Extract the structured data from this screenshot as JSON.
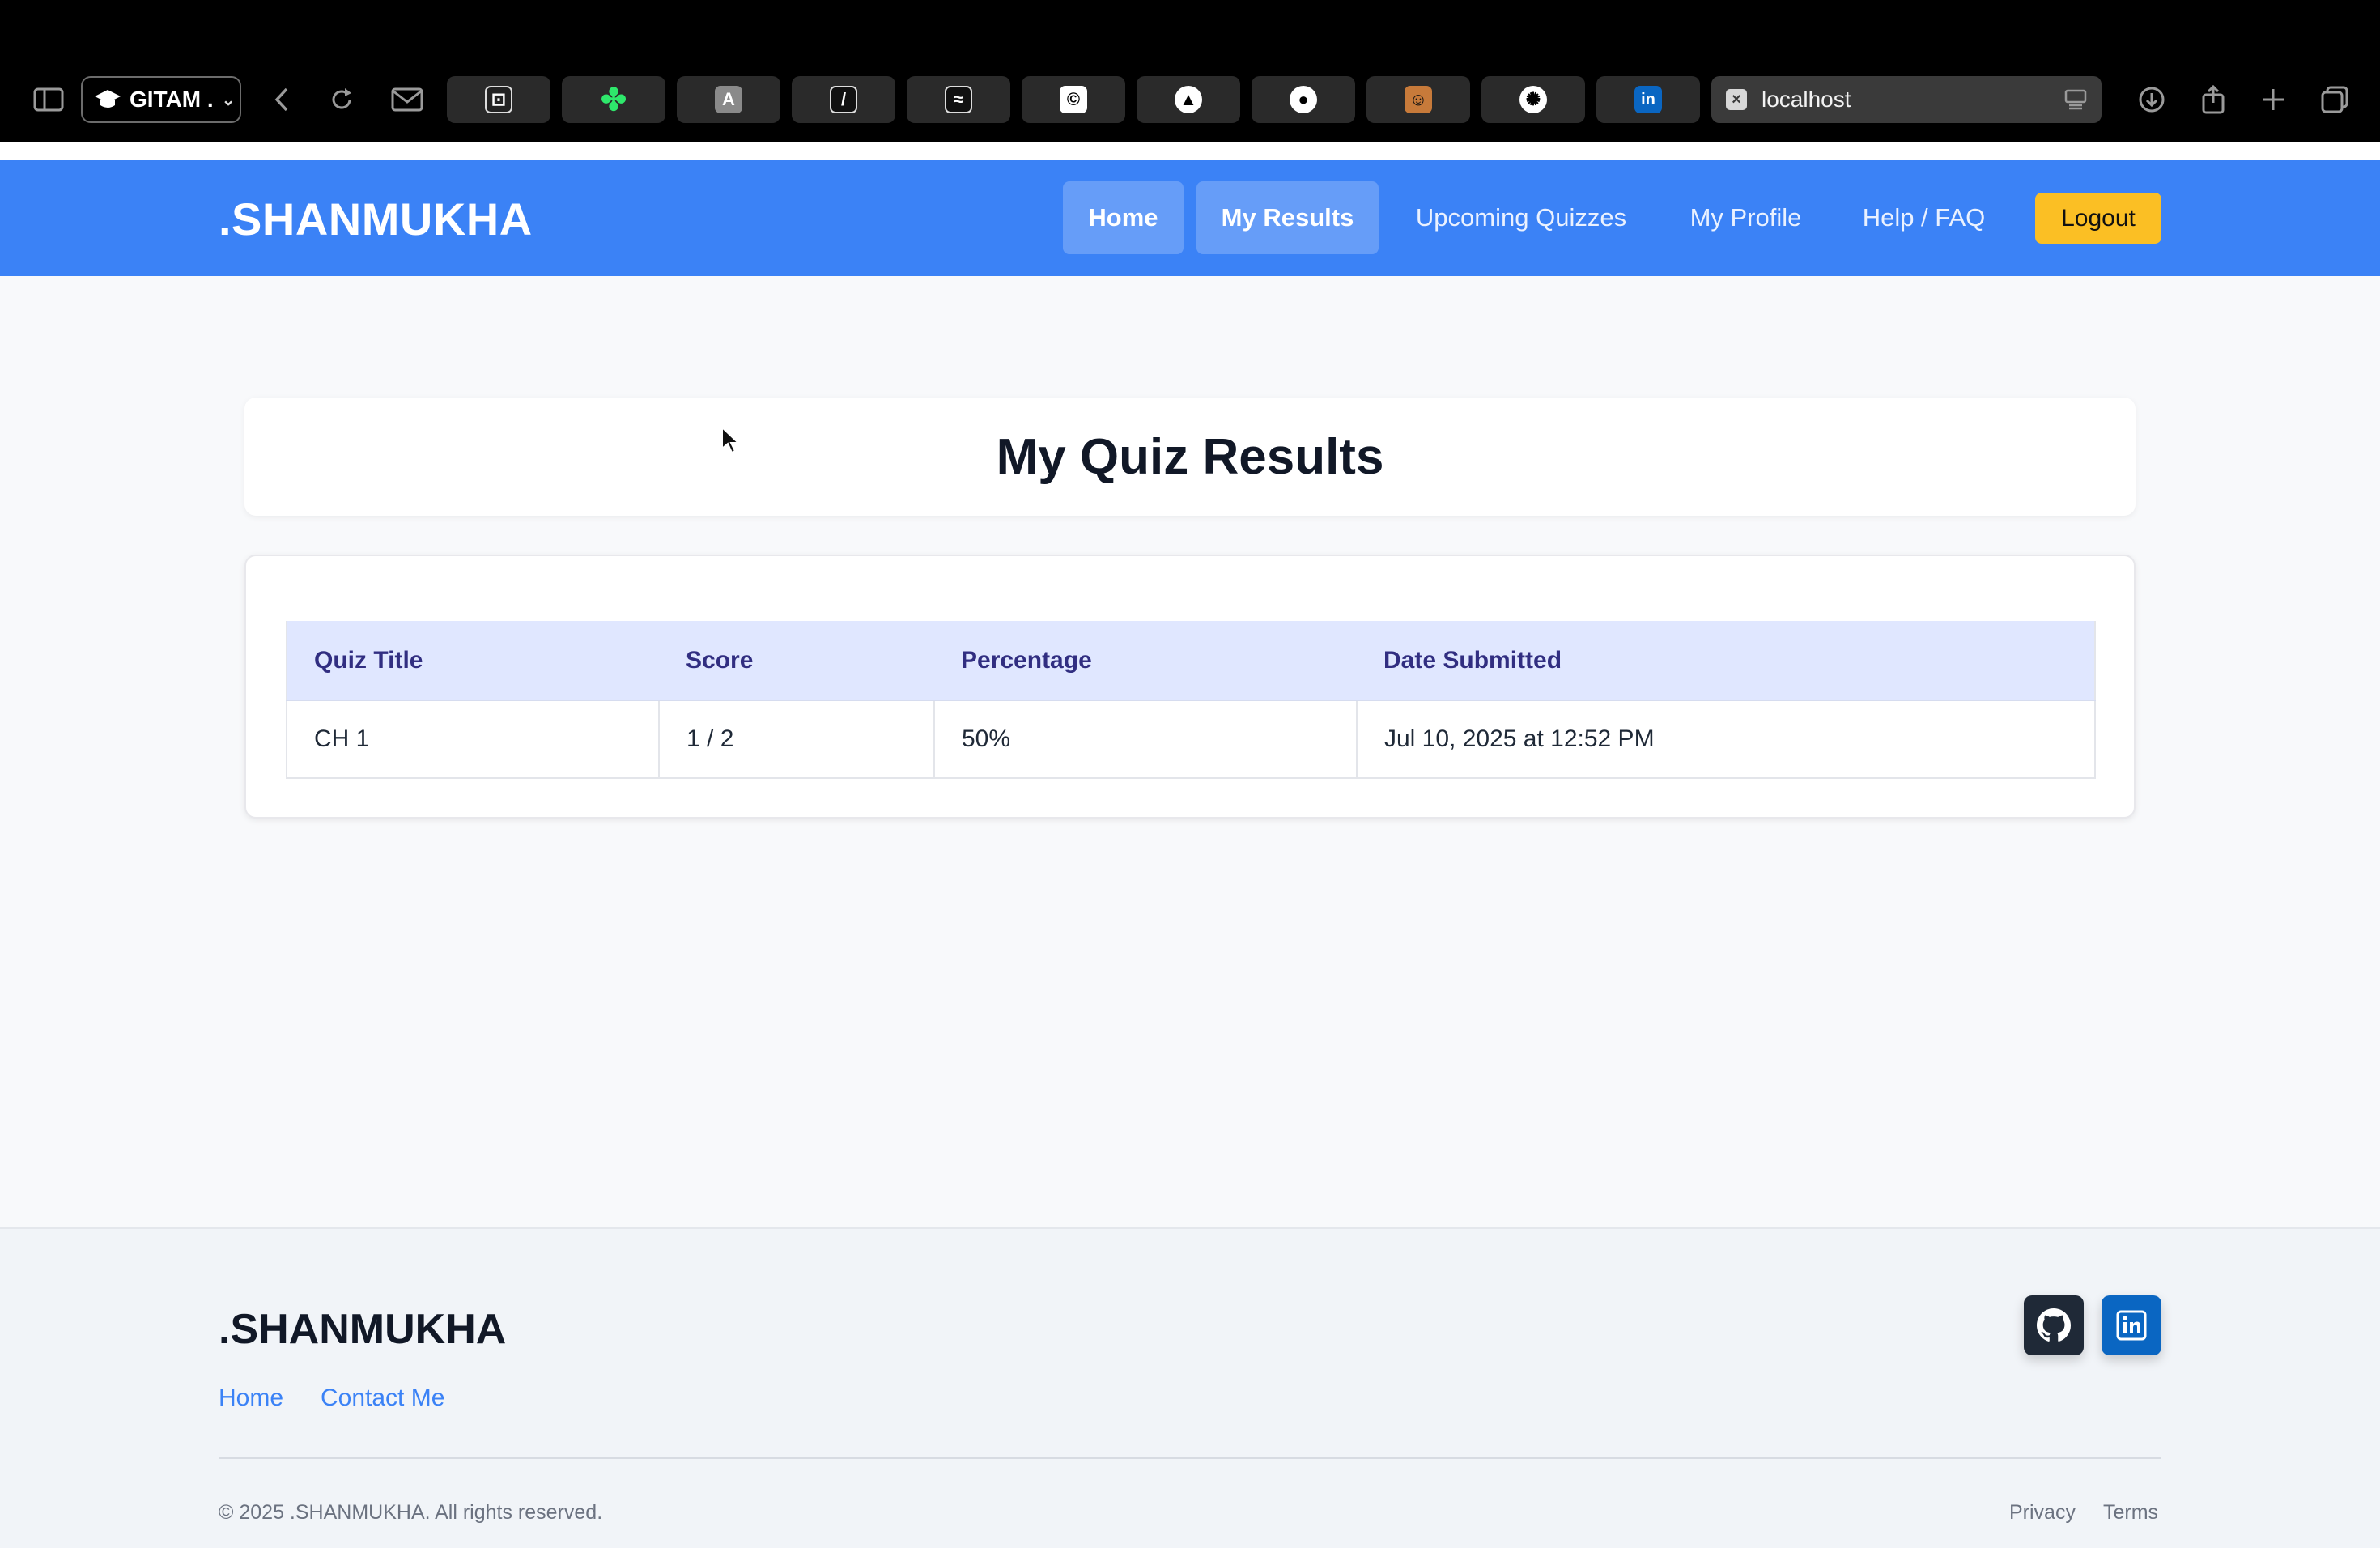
{
  "browser": {
    "tab_group_label": "GITAM .",
    "address": "localhost",
    "pinned_tabs": [
      {
        "icon": "tab-box-icon",
        "glyph": "⊡"
      },
      {
        "icon": "clover-icon",
        "glyph": "✤"
      },
      {
        "icon": "anthropic-icon",
        "glyph": "A"
      },
      {
        "icon": "slash-icon",
        "glyph": "/"
      },
      {
        "icon": "wave-icon",
        "glyph": "≈"
      },
      {
        "icon": "copyright-icon",
        "glyph": "©"
      },
      {
        "icon": "triangle-icon",
        "glyph": "▲"
      },
      {
        "icon": "github-icon",
        "glyph": "●"
      },
      {
        "icon": "avatar-icon",
        "glyph": "☺"
      },
      {
        "icon": "openai-icon",
        "glyph": "✺"
      },
      {
        "icon": "linkedin-icon",
        "glyph": "in"
      }
    ]
  },
  "navbar": {
    "brand": ".SHANMUKHA",
    "links": {
      "home": "Home",
      "results": "My Results",
      "upcoming": "Upcoming Quizzes",
      "profile": "My Profile",
      "help": "Help / FAQ"
    },
    "logout": "Logout",
    "color": "#3b82f6",
    "logout_color": "#fbbf24"
  },
  "main": {
    "title": "My Quiz Results",
    "table": {
      "headers": [
        "Quiz Title",
        "Score",
        "Percentage",
        "Date Submitted"
      ],
      "rows": [
        [
          "CH 1",
          "1 / 2",
          "50%",
          "Jul 10, 2025 at 12:52 PM"
        ]
      ]
    }
  },
  "footer": {
    "brand": ".SHANMUKHA",
    "links": {
      "home": "Home",
      "contact": "Contact Me"
    },
    "copyright": "© 2025 .SHANMUKHA. All rights reserved.",
    "privacy": "Privacy",
    "terms": "Terms"
  }
}
